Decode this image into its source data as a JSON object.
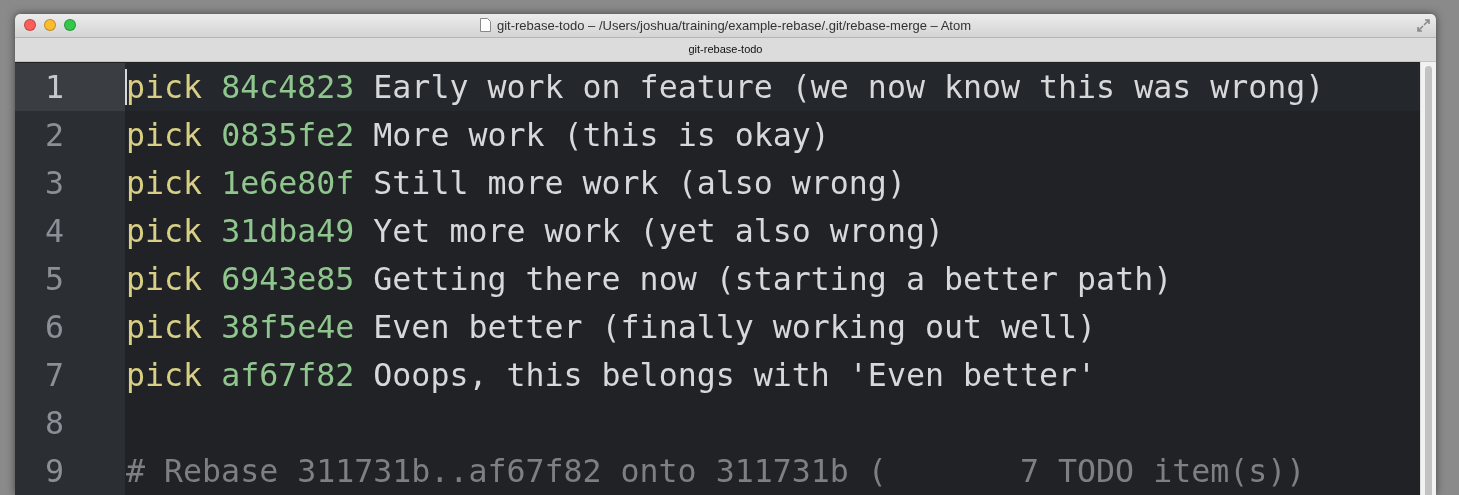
{
  "window": {
    "title": "git-rebase-todo – /Users/joshua/training/example-rebase/.git/rebase-merge – Atom"
  },
  "tabs": [
    {
      "label": "git-rebase-todo",
      "selected": true
    }
  ],
  "editor": {
    "lines": [
      {
        "number": "1",
        "kind": "pick",
        "cursor": true,
        "keyword": "pick",
        "hash": "84c4823",
        "message": "Early work on feature (we now know this was wrong)"
      },
      {
        "number": "2",
        "kind": "pick",
        "cursor": false,
        "keyword": "pick",
        "hash": "0835fe2",
        "message": "More work (this is okay)"
      },
      {
        "number": "3",
        "kind": "pick",
        "cursor": false,
        "keyword": "pick",
        "hash": "1e6e80f",
        "message": "Still more work (also wrong)"
      },
      {
        "number": "4",
        "kind": "pick",
        "cursor": false,
        "keyword": "pick",
        "hash": "31dba49",
        "message": "Yet more work (yet also wrong)"
      },
      {
        "number": "5",
        "kind": "pick",
        "cursor": false,
        "keyword": "pick",
        "hash": "6943e85",
        "message": "Getting there now (starting a better path)"
      },
      {
        "number": "6",
        "kind": "pick",
        "cursor": false,
        "keyword": "pick",
        "hash": "38f5e4e",
        "message": "Even better (finally working out well)"
      },
      {
        "number": "7",
        "kind": "pick",
        "cursor": false,
        "keyword": "pick",
        "hash": "af67f82",
        "message": "Ooops, this belongs with 'Even better'"
      },
      {
        "number": "8",
        "kind": "blank",
        "cursor": false
      },
      {
        "number": "9",
        "kind": "comment",
        "cursor": false,
        "text": "# Rebase 311731b..af67f82 onto 311731b (       7 TODO item(s))"
      }
    ]
  }
}
